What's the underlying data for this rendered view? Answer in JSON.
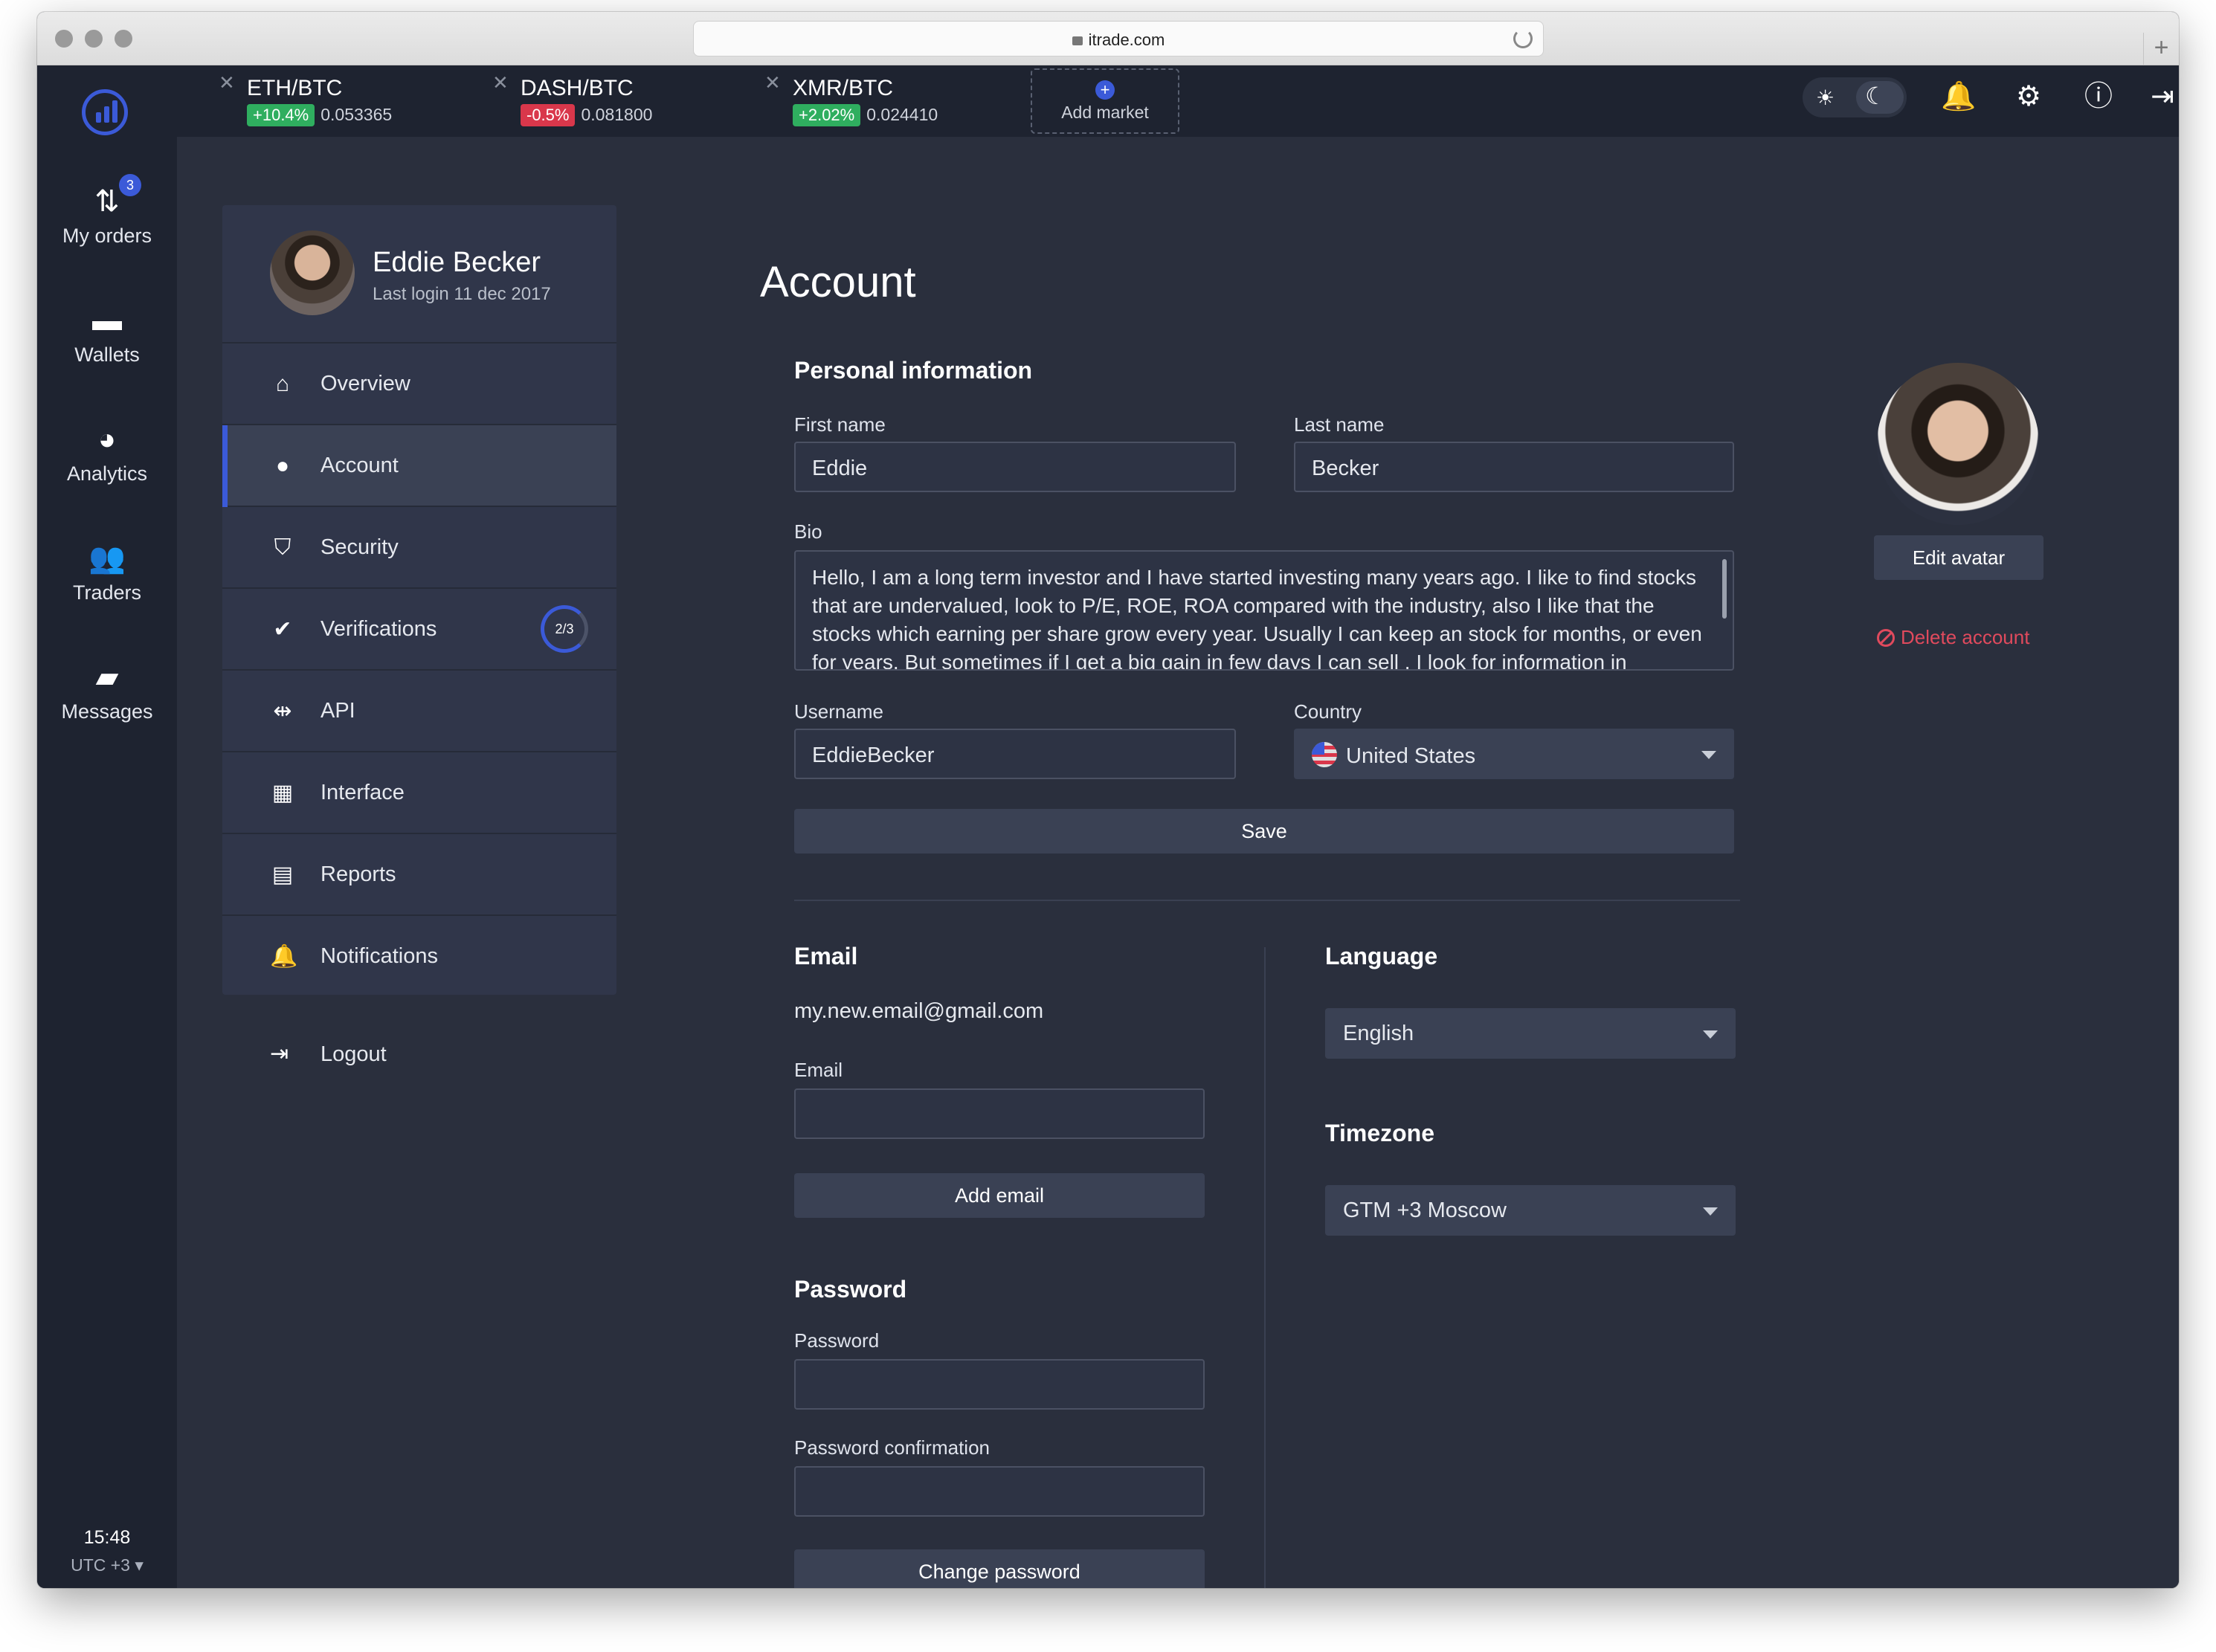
{
  "browser": {
    "url": "itrade.com"
  },
  "rail": {
    "items": [
      {
        "label": "My orders",
        "icon": "arrows-up-down-icon",
        "badge": "3"
      },
      {
        "label": "Wallets",
        "icon": "wallet-icon"
      },
      {
        "label": "Analytics",
        "icon": "pie-chart-icon"
      },
      {
        "label": "Traders",
        "icon": "users-icon"
      },
      {
        "label": "Messages",
        "icon": "chat-bubble-icon"
      }
    ],
    "time": "15:48",
    "timezone": "UTC +3 ▾"
  },
  "markets": [
    {
      "pair": "ETH/BTC",
      "change": "+10.4%",
      "price": "0.053365",
      "trend": "up"
    },
    {
      "pair": "DASH/BTC",
      "change": "-0.5%",
      "price": "0.081800",
      "trend": "down"
    },
    {
      "pair": "XMR/BTC",
      "change": "+2.02%",
      "price": "0.024410",
      "trend": "up"
    }
  ],
  "add_market": "Add market",
  "profile": {
    "name": "Eddie Becker",
    "last_login": "Last login 11 dec 2017"
  },
  "menu": {
    "items": [
      {
        "label": "Overview",
        "icon": "home-icon"
      },
      {
        "label": "Account",
        "icon": "user-icon"
      },
      {
        "label": "Security",
        "icon": "shield-icon"
      },
      {
        "label": "Verifications",
        "icon": "check-badge-icon",
        "progress": "2/3"
      },
      {
        "label": "API",
        "icon": "plug-icon"
      },
      {
        "label": "Interface",
        "icon": "grid-icon"
      },
      {
        "label": "Reports",
        "icon": "document-icon"
      },
      {
        "label": "Notifications",
        "icon": "bell-icon"
      }
    ],
    "logout": "Logout"
  },
  "account": {
    "title": "Account",
    "personal_title": "Personal information",
    "first_name_label": "First name",
    "first_name": "Eddie",
    "last_name_label": "Last name",
    "last_name": "Becker",
    "bio_label": "Bio",
    "bio": "Hello, I am a long term investor and I have started investing many years ago. I like to find stocks that are undervalued,  look to P/E, ROE, ROA compared with the industry, also I like that the stocks which earning per share grow every year. Usually I can keep an stock for months, or even for years. But sometimes if I get a big gain in few days I can sell . I look for information in",
    "username_label": "Username",
    "username": "EddieBecker",
    "country_label": "Country",
    "country": "United States",
    "save": "Save",
    "edit_avatar": "Edit avatar",
    "delete_account": "Delete account"
  },
  "email": {
    "title": "Email",
    "current": "my.new.email@gmail.com",
    "field_label": "Email",
    "add_button": "Add email"
  },
  "password": {
    "title": "Password",
    "password_label": "Password",
    "confirm_label": "Password confirmation",
    "change_button": "Change password"
  },
  "language": {
    "title": "Language",
    "value": "English"
  },
  "timezone": {
    "title": "Timezone",
    "value": "GTM +3 Moscow"
  },
  "colors": {
    "accent": "#3b5ad8",
    "positive": "#2fae5f",
    "negative": "#d9374b",
    "danger_text": "#e04a5d",
    "background": "#2a2f3d",
    "rail": "#1e2330"
  }
}
